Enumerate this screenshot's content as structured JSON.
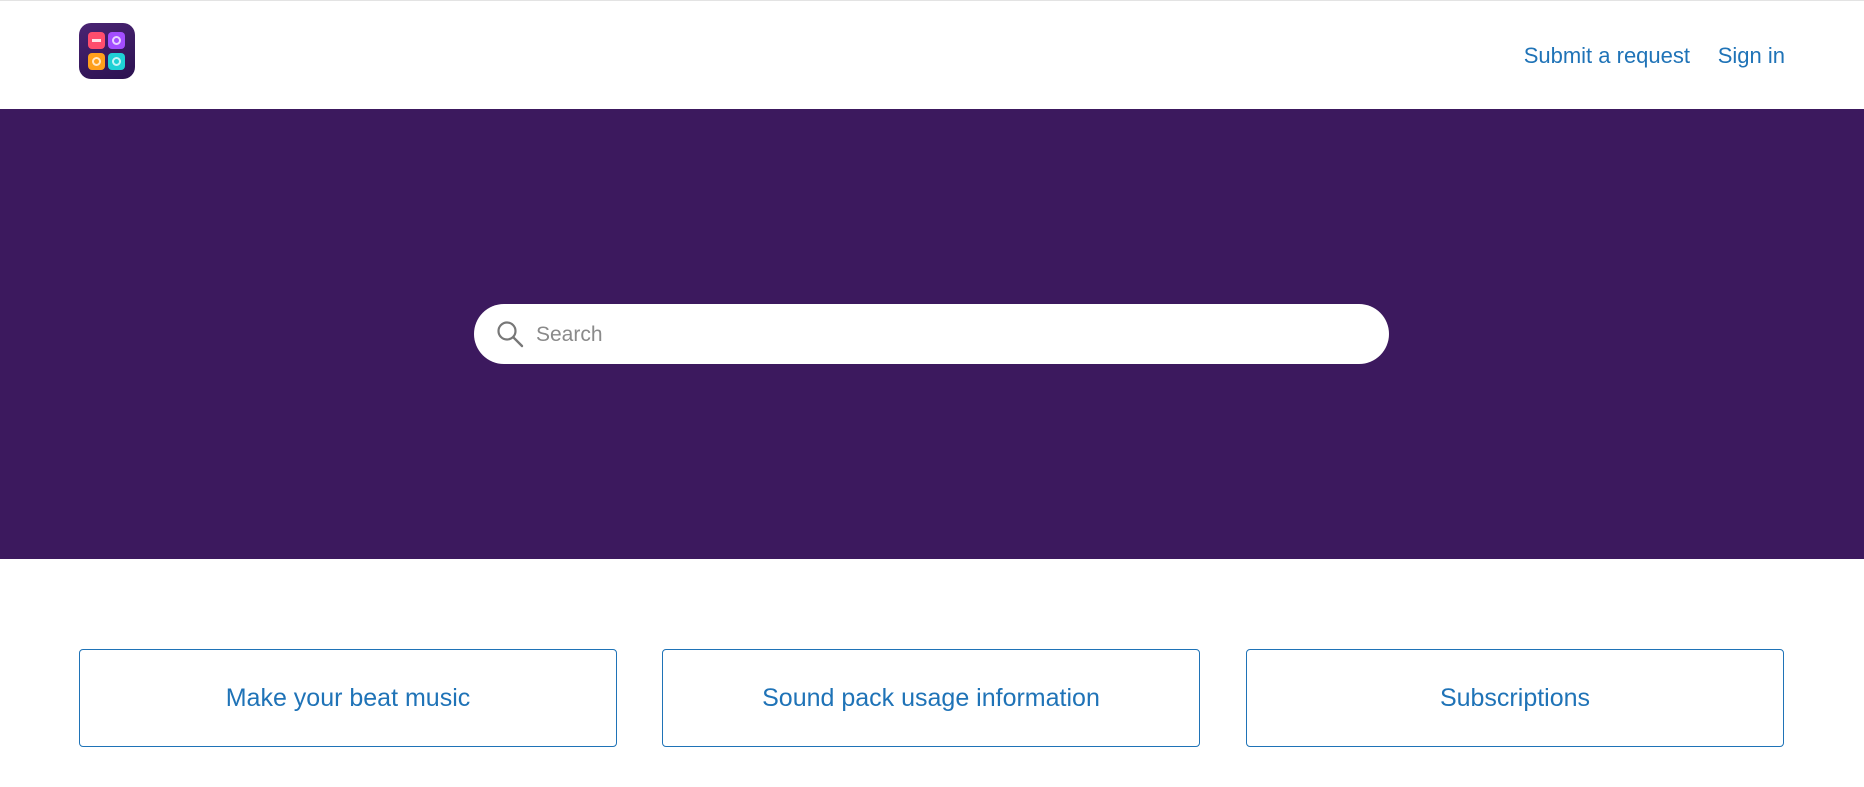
{
  "header": {
    "logo_icon": "app-logo-icon",
    "nav": {
      "submit_request": "Submit a request",
      "sign_in": "Sign in"
    },
    "link_color": "#1f73b7"
  },
  "hero": {
    "background": "#3c195e",
    "search": {
      "icon": "search-icon",
      "placeholder": "Search",
      "value": ""
    }
  },
  "categories": [
    {
      "label": "Make your beat music"
    },
    {
      "label": "Sound pack usage information"
    },
    {
      "label": "Subscriptions"
    }
  ]
}
